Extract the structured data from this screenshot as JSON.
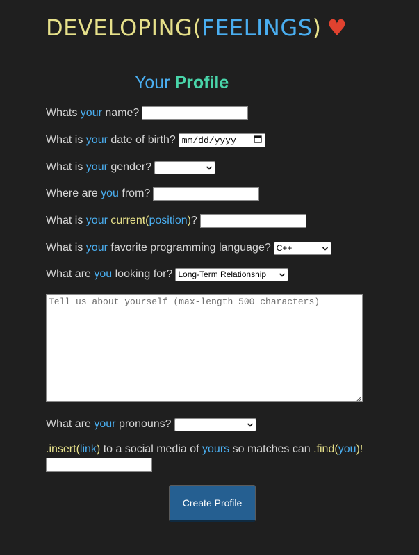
{
  "logo": {
    "part1": "DEVELOPING(",
    "part2": "FEELINGS",
    "part3": ")",
    "heart": "♥"
  },
  "title": {
    "prefix": "Your",
    "highlight": "Profile"
  },
  "questions": {
    "name": {
      "pre": "Whats",
      "kw": "your",
      "post": "name?",
      "value": ""
    },
    "dob": {
      "pre": "What is",
      "kw": "your",
      "post": "date of birth?",
      "placeholder": "mm/dd/yyyy"
    },
    "gender": {
      "pre": "What is",
      "kw": "your",
      "post": "gender?",
      "selected": ""
    },
    "from": {
      "pre": "Where are",
      "kw": "you",
      "post": "from?",
      "value": ""
    },
    "position": {
      "pre": "What is",
      "kw": "your",
      "fn": "current(",
      "arg": "position",
      "close": ")",
      "q": "?",
      "value": ""
    },
    "language": {
      "pre": "What is",
      "kw": "your",
      "post": "favorite programming language?",
      "selected": "C++"
    },
    "looking": {
      "pre": "What are",
      "kw": "you",
      "post": "looking for?",
      "selected": "Long-Term Relationship"
    },
    "pronouns": {
      "pre": "What are",
      "kw": "your",
      "post": "pronouns?",
      "selected": ""
    }
  },
  "bio": {
    "placeholder": "Tell us about yourself (max-length 500 characters)"
  },
  "social": {
    "fn1": ".insert(",
    "arg1": "link",
    "close1": ")",
    "mid": "to a social media of",
    "kw": "yours",
    "mid2": "so matches can",
    "fn2": ".find(",
    "arg2": "you",
    "close2": ")!",
    "value": ""
  },
  "submit_label": "Create Profile",
  "colors": {
    "background": "#1f1f1f",
    "keyword_blue": "#4aaef0",
    "accent_yellow": "#e6e08a",
    "accent_teal": "#49d4a9",
    "heart_red": "#e0422f",
    "button_blue": "#255f91"
  },
  "icons": {
    "heart": "heart-icon",
    "calendar": "calendar-icon",
    "dropdown": "chevron-down-icon",
    "resize": "resize-grip-icon"
  }
}
